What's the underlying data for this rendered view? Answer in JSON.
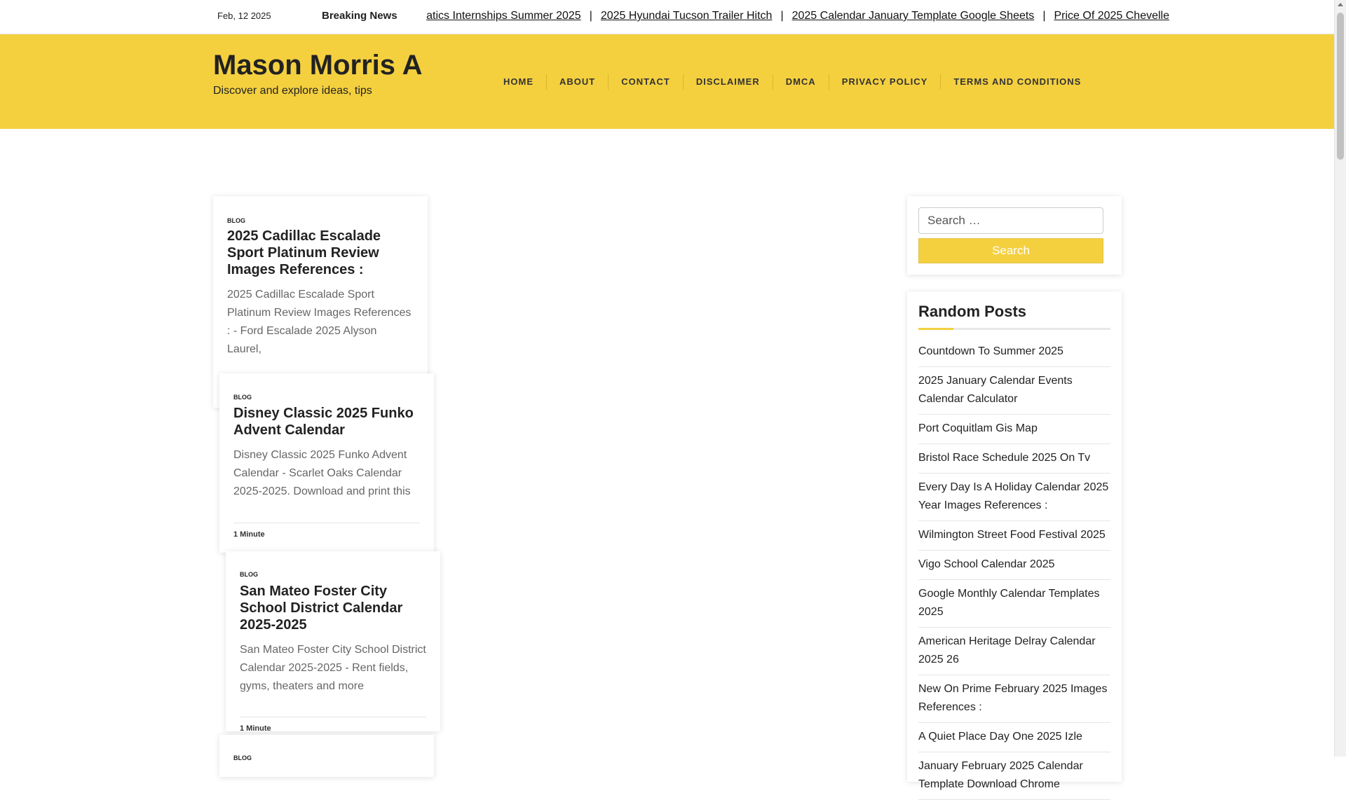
{
  "topbar": {
    "date": "Feb, 12 2025",
    "breaking_label": "Breaking News",
    "ticker": [
      "atics Internships Summer 2025",
      "2025 Hyundai Tucson Trailer Hitch",
      "2025 Calendar January Template Google Sheets",
      "Price Of 2025 Chevelle"
    ]
  },
  "header": {
    "site_title": "Mason Morris A",
    "tagline": "Discover and explore ideas, tips",
    "nav": [
      "HOME",
      "ABOUT",
      "CONTACT",
      "DISCLAIMER",
      "DMCA",
      "PRIVACY POLICY",
      "TERMS AND CONDITIONS"
    ]
  },
  "posts": [
    {
      "category": "BLOG",
      "title": "2025 Cadillac Escalade Sport Platinum Review Images References :",
      "excerpt": "2025 Cadillac Escalade Sport Platinum Review Images References : - Ford Escalade 2025 Alyson Laurel,",
      "meta": ""
    },
    {
      "category": "BLOG",
      "title": "Disney Classic 2025 Funko Advent Calendar",
      "excerpt": "Disney Classic 2025 Funko Advent Calendar - Scarlet Oaks Calendar 2025-2025. Download and print this",
      "meta": "1 Minute"
    },
    {
      "category": "BLOG",
      "title": "San Mateo Foster City School District Calendar 2025-2025",
      "excerpt": "San Mateo Foster City School District Calendar 2025-2025 - Rent fields, gyms, theaters and more",
      "meta": "1 Minute"
    },
    {
      "category": "BLOG",
      "title": "",
      "excerpt": "",
      "meta": ""
    }
  ],
  "sidebar": {
    "search": {
      "placeholder": "Search …",
      "button_label": "Search"
    },
    "random_posts": {
      "title": "Random Posts",
      "items": [
        "Countdown To Summer 2025",
        "2025 January Calendar Events Calendar Calculator",
        "Port Coquitlam Gis Map",
        "Bristol Race Schedule 2025 On Tv",
        "Every Day Is A Holiday Calendar 2025 Year Images References :",
        "Wilmington Street Food Festival 2025",
        "Vigo School Calendar 2025",
        "Google Monthly Calendar Templates 2025",
        "American Heritage Delray Calendar 2025 26",
        "New On Prime February 2025 Images References :",
        "A Quiet Place Day One 2025 Izle",
        "January February 2025 Calendar Template Download Chrome"
      ]
    }
  },
  "colors": {
    "accent": "#f4d03f",
    "text": "#222222",
    "muted": "#666666"
  }
}
